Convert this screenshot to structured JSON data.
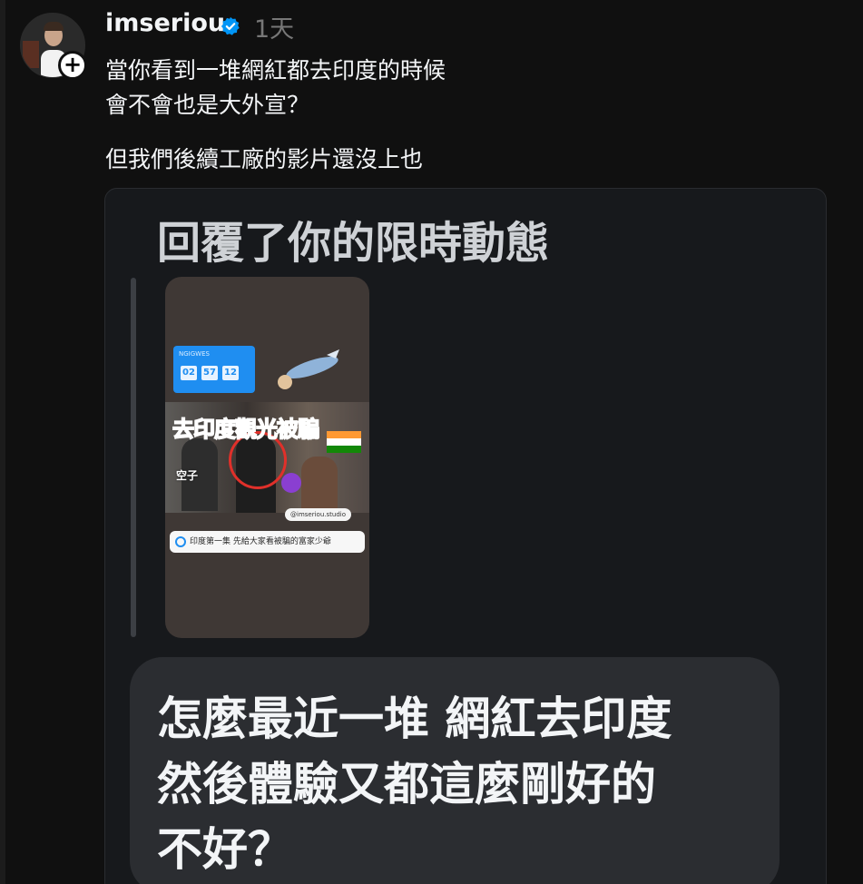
{
  "post": {
    "username": "imseriou",
    "time": "1天",
    "text_lines": [
      "當你看到一堆網紅都去印度的時候",
      "會不會也是大外宣？",
      "但我們後續工廠的影片還沒上也"
    ]
  },
  "quoted": {
    "heading": "回覆了你的限時動態",
    "story": {
      "timer_label": "NGIGWES",
      "timer_digits": [
        "02",
        "57",
        "12"
      ],
      "banner_title": "去印度觀光被騙",
      "sub_label": "空子",
      "handle": "@imseriou.studio",
      "link_text": "印度第一集 先給大家看被騙的富家少爺"
    },
    "reply_lines": [
      "怎麼最近一堆 網紅去印度",
      "然後體驗又都這麼剛好的",
      "不好？"
    ]
  },
  "colors": {
    "background": "#101010",
    "verified_blue": "#0095f6",
    "banner_red": "#e6322a"
  }
}
